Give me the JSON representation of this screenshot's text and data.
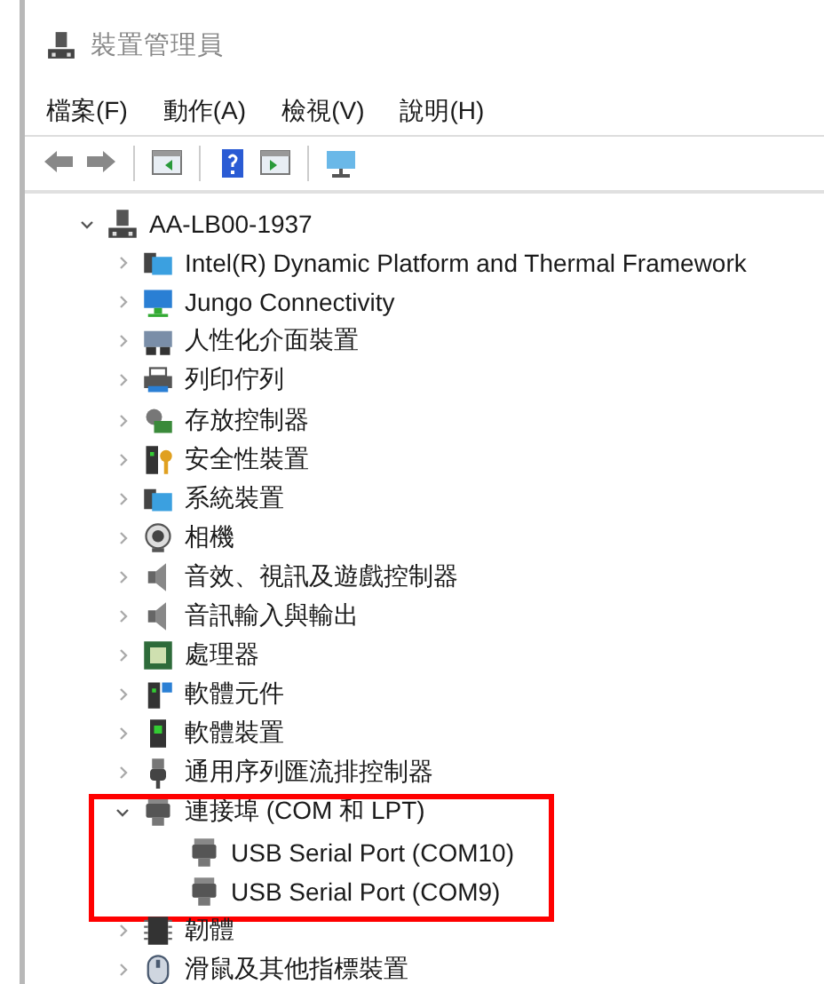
{
  "window": {
    "title": "裝置管理員"
  },
  "menu": [
    {
      "label": "檔案(F)"
    },
    {
      "label": "動作(A)"
    },
    {
      "label": "檢視(V)"
    },
    {
      "label": "說明(H)"
    }
  ],
  "toolbar": [
    {
      "kind": "back"
    },
    {
      "kind": "forward"
    },
    {
      "kind": "sep"
    },
    {
      "kind": "panel"
    },
    {
      "kind": "sep"
    },
    {
      "kind": "help"
    },
    {
      "kind": "panel2"
    },
    {
      "kind": "sep"
    },
    {
      "kind": "monitor"
    }
  ],
  "tree": {
    "label": "AA-LB00-1937",
    "kind": "computer",
    "expanded": true,
    "children": [
      {
        "label": "Intel(R) Dynamic Platform and Thermal Framework",
        "kind": "folder",
        "expanded": false
      },
      {
        "label": "Jungo Connectivity",
        "kind": "network",
        "expanded": false
      },
      {
        "label": "人性化介面裝置",
        "kind": "hid",
        "expanded": false
      },
      {
        "label": "列印佇列",
        "kind": "printer",
        "expanded": false
      },
      {
        "label": "存放控制器",
        "kind": "storage",
        "expanded": false
      },
      {
        "label": "安全性裝置",
        "kind": "security",
        "expanded": false
      },
      {
        "label": "系統裝置",
        "kind": "folder",
        "expanded": false
      },
      {
        "label": "相機",
        "kind": "camera",
        "expanded": false
      },
      {
        "label": "音效、視訊及遊戲控制器",
        "kind": "audio",
        "expanded": false
      },
      {
        "label": "音訊輸入與輸出",
        "kind": "audio",
        "expanded": false
      },
      {
        "label": "處理器",
        "kind": "cpu",
        "expanded": false
      },
      {
        "label": "軟體元件",
        "kind": "component",
        "expanded": false
      },
      {
        "label": "軟體裝置",
        "kind": "device",
        "expanded": false
      },
      {
        "label": "通用序列匯流排控制器",
        "kind": "usb",
        "expanded": false
      },
      {
        "label": "連接埠 (COM 和 LPT)",
        "kind": "port",
        "expanded": true,
        "highlighted": true,
        "children": [
          {
            "label": "USB Serial Port (COM10)",
            "kind": "port"
          },
          {
            "label": "USB Serial Port (COM9)",
            "kind": "port"
          }
        ]
      },
      {
        "label": "韌體",
        "kind": "firmware",
        "expanded": false
      },
      {
        "label": "滑鼠及其他指標裝置",
        "kind": "mouse",
        "expanded": false
      }
    ]
  }
}
